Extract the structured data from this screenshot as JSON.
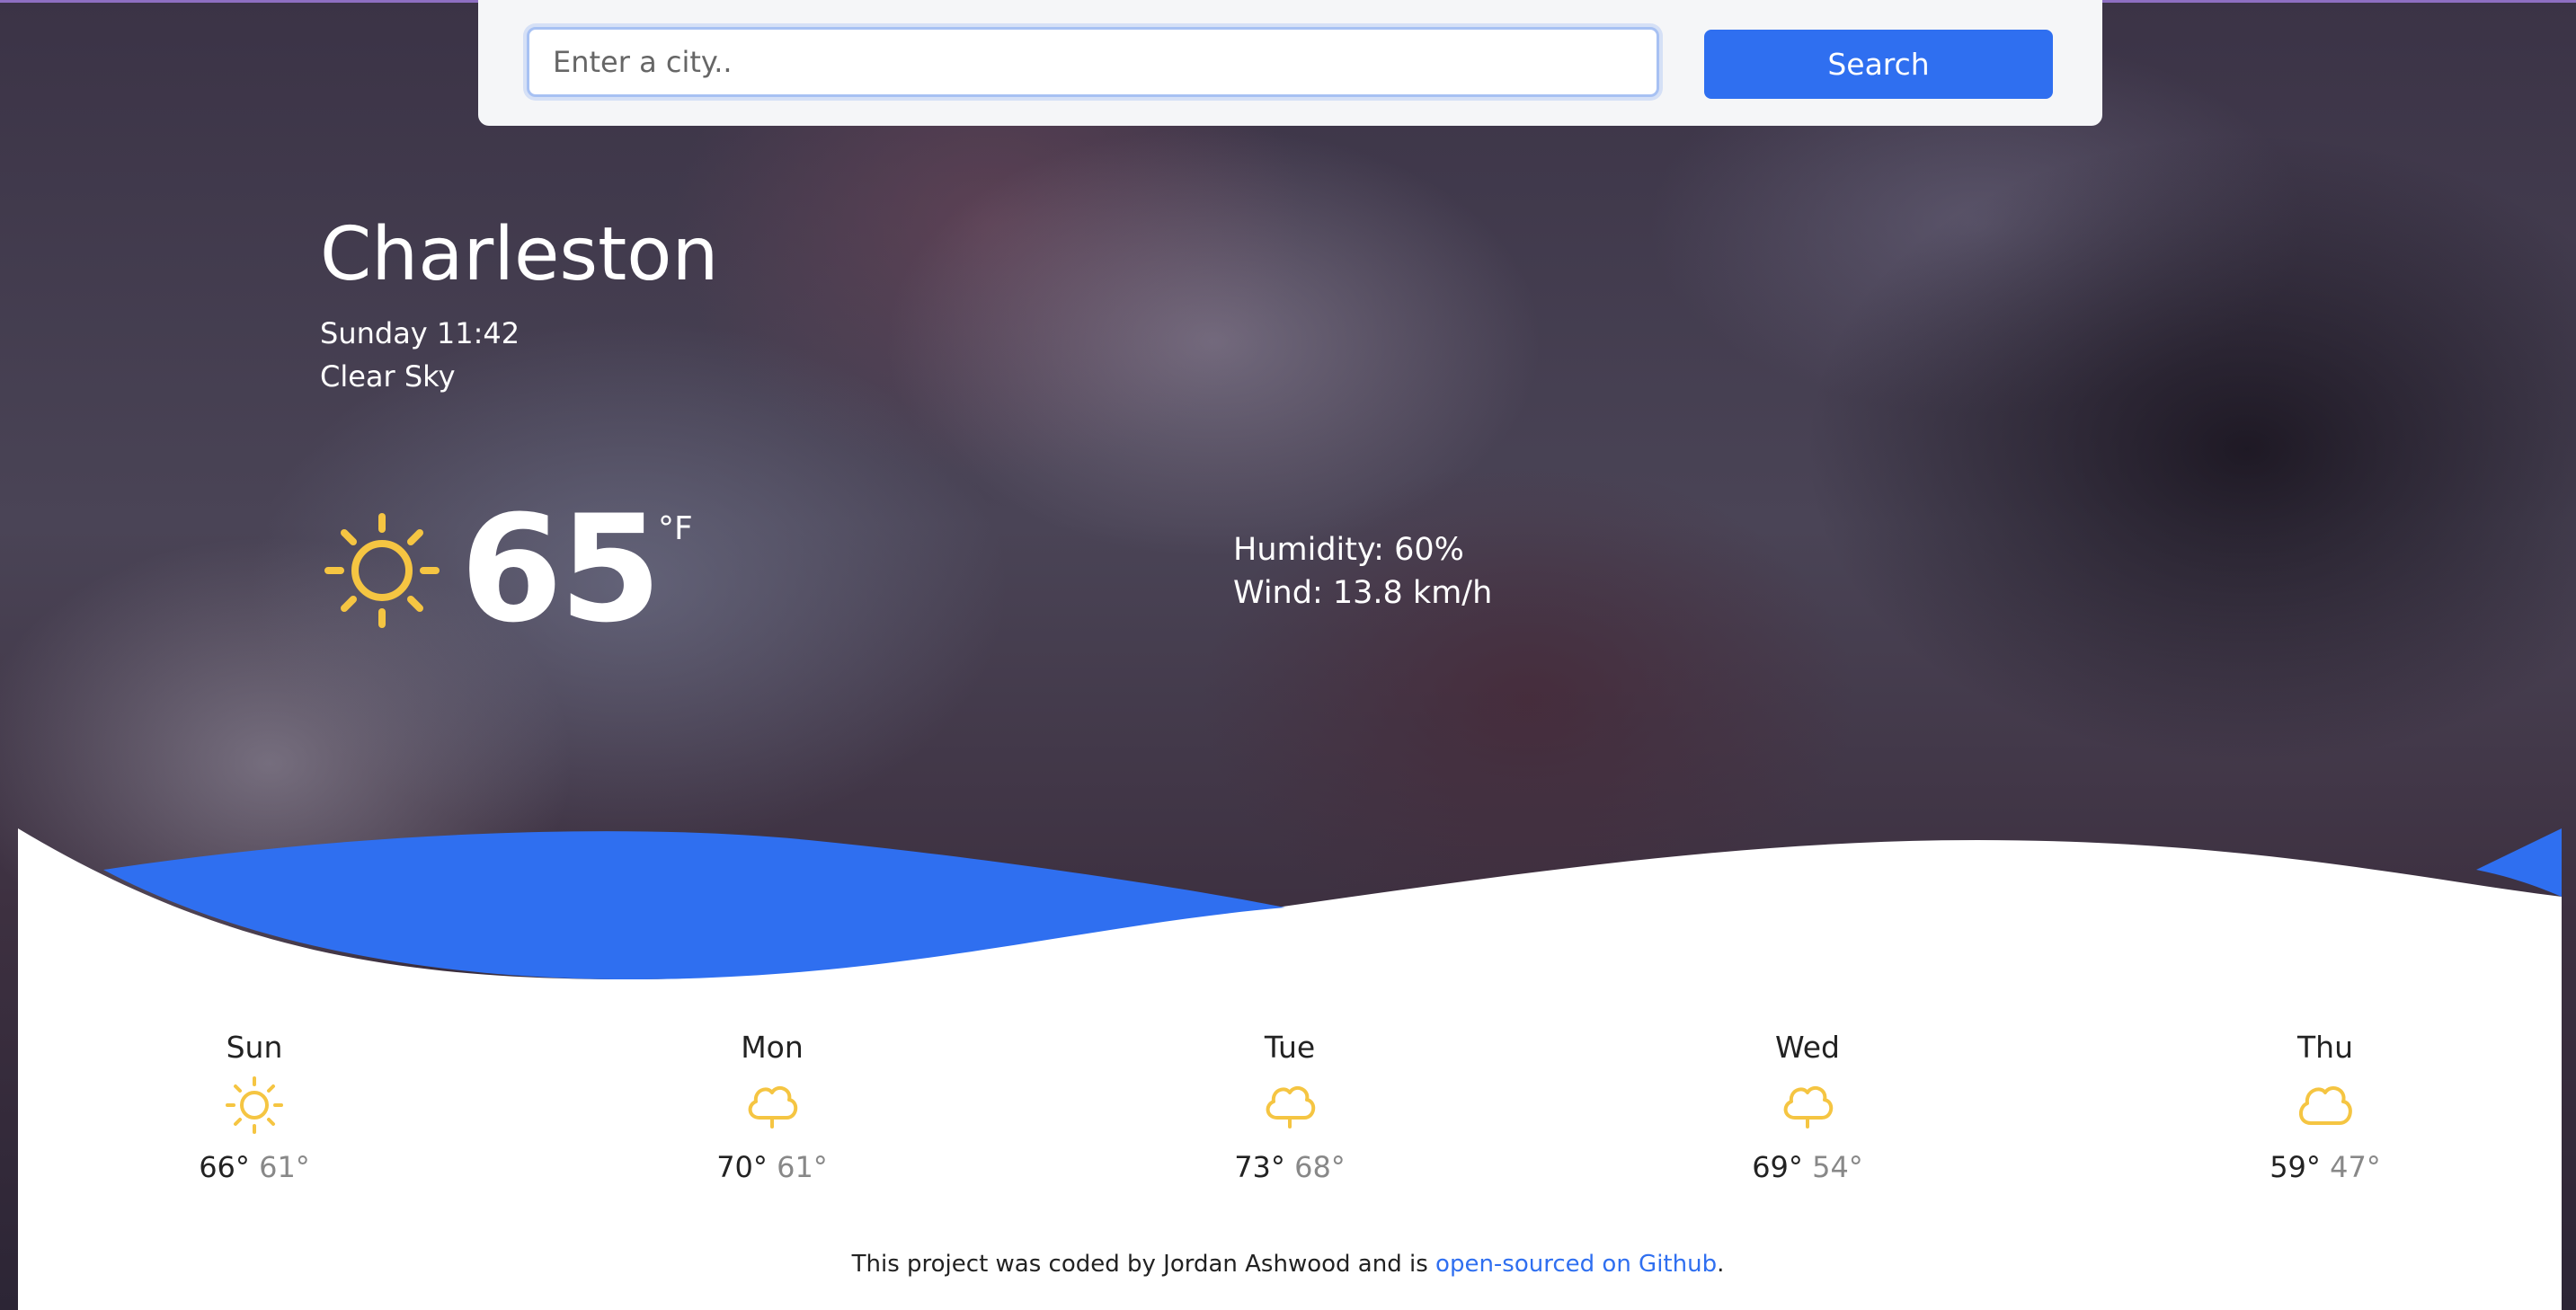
{
  "search": {
    "placeholder": "Enter a city..",
    "button_label": "Search"
  },
  "current": {
    "city": "Charleston",
    "datetime": "Sunday 11:42",
    "condition": "Clear Sky",
    "temperature": "65",
    "unit": "°F",
    "humidity": "Humidity: 60%",
    "wind": "Wind: 13.8 km/h",
    "icon": "sun-icon"
  },
  "forecast": [
    {
      "day": "Sun",
      "high": "66°",
      "low": "61°",
      "icon": "sun-icon"
    },
    {
      "day": "Mon",
      "high": "70°",
      "low": "61°",
      "icon": "cloud-icon"
    },
    {
      "day": "Tue",
      "high": "73°",
      "low": "68°",
      "icon": "cloud-icon"
    },
    {
      "day": "Wed",
      "high": "69°",
      "low": "54°",
      "icon": "cloud-icon"
    },
    {
      "day": "Thu",
      "high": "59°",
      "low": "47°",
      "icon": "cloud-icon"
    }
  ],
  "footer": {
    "text": "This project was coded by Jordan Ashwood and is",
    "link_text": "open-sourced on Github",
    "end": "."
  },
  "colors": {
    "accent": "#2f6ff0",
    "icon": "#f5c542",
    "wave": "#2f6ff0"
  }
}
